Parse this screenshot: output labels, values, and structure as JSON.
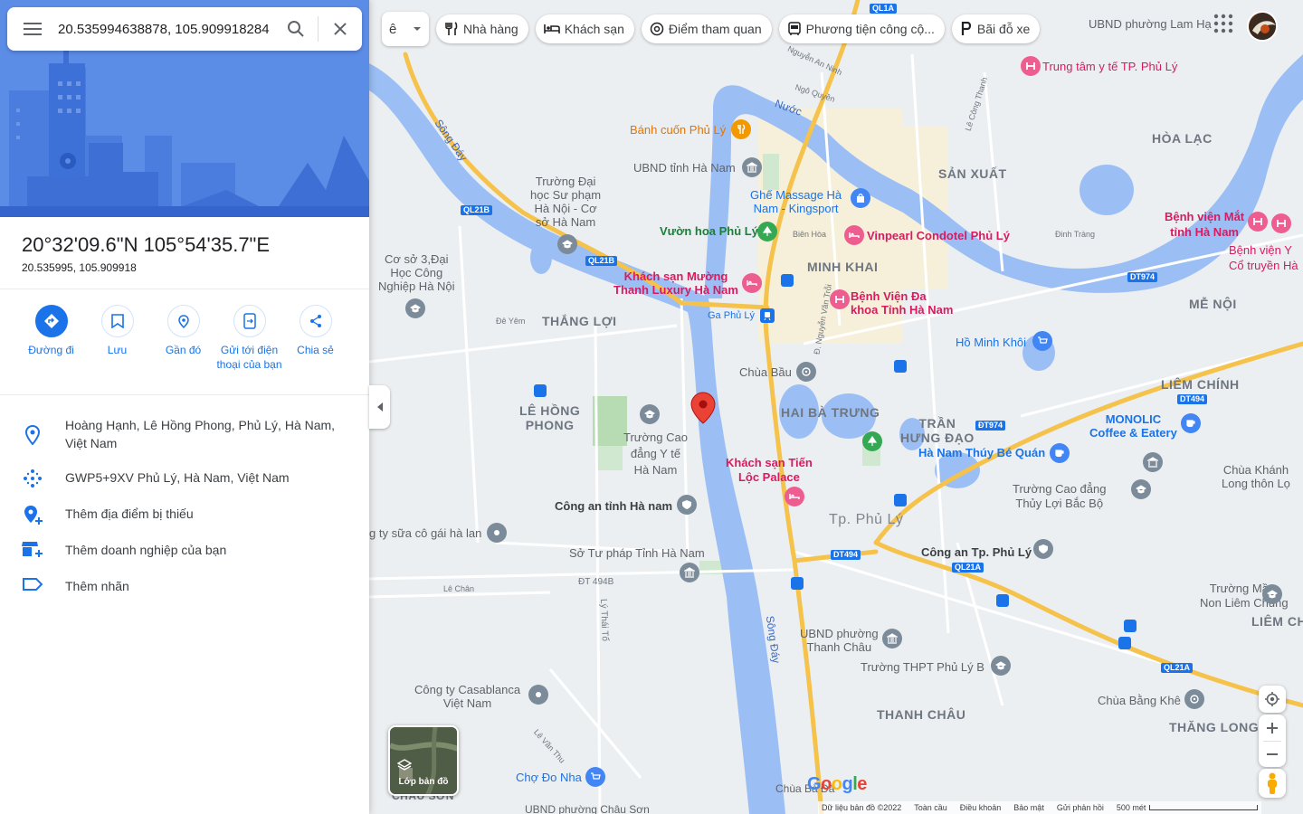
{
  "search": {
    "value": "20.535994638878, 105.909918284"
  },
  "place": {
    "title": "20°32'09.6\"N 105°54'35.7\"E",
    "subtitle": "20.535995, 105.909918"
  },
  "actions": [
    {
      "label": "Đường đi"
    },
    {
      "label": "Lưu"
    },
    {
      "label": "Gần đó"
    },
    {
      "label": "Gửi tới điện thoại của bạn"
    },
    {
      "label": "Chia sẻ"
    }
  ],
  "info": {
    "address": "Hoàng Hạnh, Lê Hồng Phong, Phủ Lý, Hà Nam, Việt Nam",
    "pluscode": "GWP5+9XV Phủ Lý, Hà Nam, Việt Nam",
    "add_missing": "Thêm địa điểm bị thiếu",
    "add_business": "Thêm doanh nghiệp của bạn",
    "add_label": "Thêm nhãn"
  },
  "chips": {
    "first": "ê",
    "restaurants": "Nhà hàng",
    "hotels": "Khách sạn",
    "attractions": "Điểm tham quan",
    "transit": "Phương tiện công cộ...",
    "parking": "Bãi đỗ xe"
  },
  "layers_label": "Lớp bản đồ",
  "map_labels": {
    "areas": {
      "thang_loi": "THẮNG LỢI",
      "le_hong_phong": "LÊ HỒNG\nPHONG",
      "minh_khai": "MINH KHAI",
      "hai_ba_trung": "HAI BÀ TRƯNG",
      "tran_hung_dao": "TRẦN\nHƯNG ĐẠO",
      "san_xuat": "SẢN XUẤT",
      "hoa_lac": "HÒA LẠC",
      "me_noi": "MỄ NỘI",
      "liem_chinh": "LIÊM CHÍNH",
      "tp_phu_ly": "Tp. Phủ Lý",
      "thanh_chau": "THANH CHÂU",
      "thang_long": "THĂNG LONG",
      "liem_chu": "LIÊM CHU",
      "chau_son": "CHÂU SƠN"
    },
    "pois": {
      "banh_cuon": "Bánh cuốn Phủ Lý",
      "ubnd_tinh": "UBND tỉnh Hà Nam",
      "truong_dhsp": "Trường Đại\nhọc Sư phạm\nHà Nội - Cơ\nsở Hà Nam",
      "ghe_massage": "Ghế Massage Hà\nNam - Kingsport",
      "vinpearl": "Vinpearl Condotel Phủ Lý",
      "vuon_hoa": "Vườn hoa Phủ Lý",
      "co_so_3": "Cơ sở 3,Đại\nHọc Công\nNghiệp Hà Nội",
      "ks_muong_thanh": "Khách sạn Mường\nThanh Luxury Hà Nam",
      "ga_phu_ly": "Ga Phủ Lý",
      "bv_da_khoa": "Bệnh Viện Đa\nkhoa Tỉnh Hà Nam",
      "ho_minh_khoi": "Hồ Minh Khôi",
      "chua_bau": "Chùa Bầu",
      "truong_cd_yte": "Trường Cao\nđẳng Y tế\nHà Nam",
      "ks_tien_loc": "Khách sạn Tiến\nLộc Palace",
      "cong_an_tinh": "Công an tỉnh Hà nam",
      "cty_sua": "g ty sữa cô gái hà lan",
      "so_tu_phap": "Sở Tư pháp Tỉnh Hà Nam",
      "ha_nam_thuy_be": "Hà Nam Thúy Bé Quán",
      "monolic": "MONOLIC\nCoffee & Eatery",
      "chua_khanh": "Chùa Khánh\nLong thôn Lọ",
      "cd_thuy_loi": "Trường Cao đẳng\nThủy Lợi Bắc Bộ",
      "cong_an_tp": "Công an Tp. Phủ Lý",
      "mam_non": "Trường Mầm\nNon Liêm Chung",
      "ubnd_thanh_chau": "UBND phường\nThanh Châu",
      "thpt_phu_ly_b": "Trường THPT Phủ Lý B",
      "casablanca": "Công ty Casablanca\nViệt Nam",
      "chua_bang_khe": "Chùa Bằng Khê",
      "cho_do_nha": "Chợ Đo Nha",
      "ubnd_chau_son": "UBND phường Châu Sơn",
      "chua_ba": "Chùa Bà Đá",
      "ttyt": "Trung tâm y tế TP. Phủ Lý",
      "ubnd_lam_ha": "UBND phường Lam Hạ",
      "bv_mat": "Bệnh viện Mắt\ntỉnh Hà Nam",
      "bv_y_co": "Bệnh viện Y\nCổ truyền Hà"
    },
    "water": {
      "song_day_1": "Sông Đáy",
      "song_day_2": "Sông Đáy",
      "nuoc": "Nước"
    },
    "streets": {
      "le_chan": "Lê Chân",
      "dt494b": "ĐT 494B",
      "ly_thai_to": "Lý Thái Tổ",
      "nguyen_an_ninh": "Nguyễn An Ninh",
      "le_cong_thanh": "Lê Công Thanh",
      "bien_hoa": "Biên Hòa",
      "ngo_quyen": "Ngô Quyền",
      "de_yem": "Đê Yêm",
      "dinh_trang": "Đinh Tràng",
      "le_van_thu": "Lê Văn Thu",
      "nguyen_trai": "Đ. Nguyễn Văn Trỗi"
    },
    "badges": {
      "ql21b_a": "QL21B",
      "ql21b_b": "QL21B",
      "ql1a_top": "QL1A",
      "dt974_a": "ĐT974",
      "dt974_b": "DT974",
      "dt494_a": "DT494",
      "dt494_b": "DT494",
      "ql21a_a": "QL21A",
      "ql21a_b": "QL21A"
    }
  },
  "footer": {
    "data": "Dữ liệu bản đồ ©2022",
    "global": "Toàn cầu",
    "terms": "Điều khoản",
    "privacy": "Bảo mật",
    "feedback": "Gửi phản hồi",
    "scale": "500 mét"
  },
  "google_logo": "Google",
  "colors": {
    "accent": "#1a73e8",
    "pin": "#ea4335",
    "water": "#9bbff4",
    "road_major": "#fbd267",
    "hero_bg": "#4a7fe0"
  }
}
